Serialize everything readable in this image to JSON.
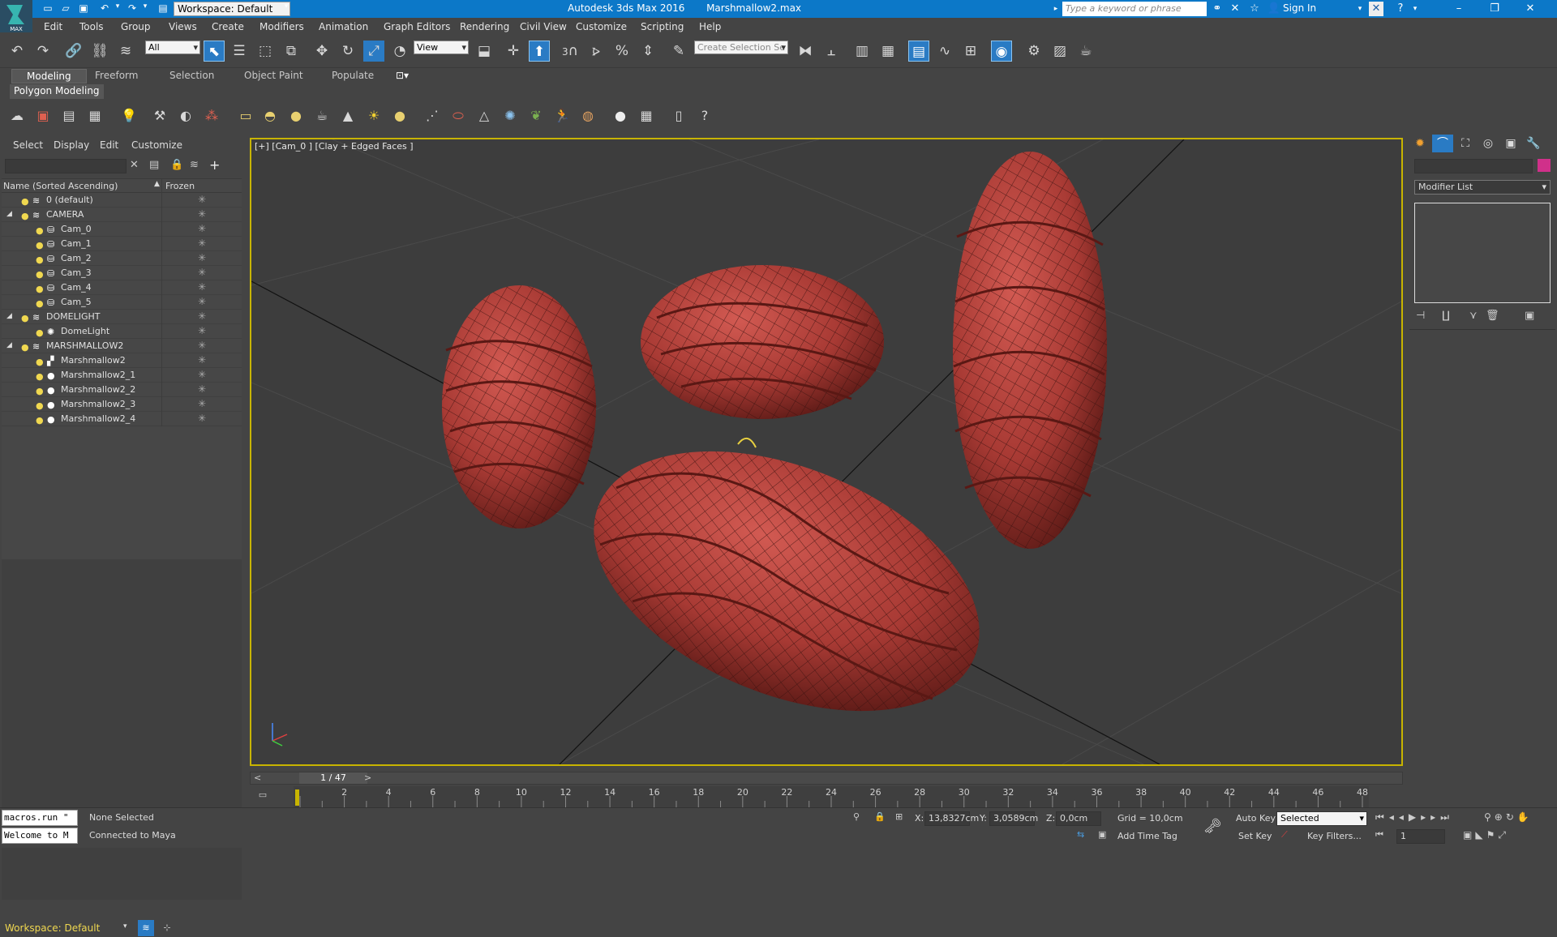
{
  "titlebar": {
    "workspace": "Workspace: Default",
    "app_title": "Autodesk 3ds Max 2016",
    "file_name": "Marshmallow2.max",
    "search_placeholder": "Type a keyword or phrase",
    "sign_in": "Sign In",
    "logo_text": "MAX"
  },
  "menu": [
    "Edit",
    "Tools",
    "Group",
    "Views",
    "Create",
    "Modifiers",
    "Animation",
    "Graph Editors",
    "Rendering",
    "Civil View",
    "Customize",
    "Scripting",
    "Help"
  ],
  "main_toolbar": {
    "selection_filter": "All",
    "ref_coord": "View",
    "selection_set_placeholder": "Create Selection Se",
    "snap_label": "3"
  },
  "ribbon": {
    "tabs": [
      "Modeling",
      "Freeform",
      "Selection",
      "Object Paint",
      "Populate"
    ],
    "active_tab": "Modeling",
    "sub_tab": "Polygon Modeling"
  },
  "explorer": {
    "menu": [
      "Select",
      "Display",
      "Edit",
      "Customize"
    ],
    "col_name": "Name (Sorted Ascending)",
    "col_frozen": "Frozen",
    "rows": [
      {
        "name": "0 (default)",
        "level": 0,
        "type": "layer",
        "expander": ""
      },
      {
        "name": "CAMERA",
        "level": 0,
        "type": "layer",
        "expander": "◢"
      },
      {
        "name": "Cam_0",
        "level": 1,
        "type": "camera",
        "expander": ""
      },
      {
        "name": "Cam_1",
        "level": 1,
        "type": "camera",
        "expander": ""
      },
      {
        "name": "Cam_2",
        "level": 1,
        "type": "camera",
        "expander": ""
      },
      {
        "name": "Cam_3",
        "level": 1,
        "type": "camera",
        "expander": ""
      },
      {
        "name": "Cam_4",
        "level": 1,
        "type": "camera",
        "expander": ""
      },
      {
        "name": "Cam_5",
        "level": 1,
        "type": "camera",
        "expander": ""
      },
      {
        "name": "DOMELIGHT",
        "level": 0,
        "type": "layer",
        "expander": "◢"
      },
      {
        "name": "DomeLight",
        "level": 1,
        "type": "light",
        "expander": ""
      },
      {
        "name": "MARSHMALLOW2",
        "level": 0,
        "type": "layer",
        "expander": "◢"
      },
      {
        "name": "Marshmallow2",
        "level": 1,
        "type": "mesh",
        "expander": ""
      },
      {
        "name": "Marshmallow2_1",
        "level": 1,
        "type": "sphere",
        "expander": ""
      },
      {
        "name": "Marshmallow2_2",
        "level": 1,
        "type": "sphere",
        "expander": ""
      },
      {
        "name": "Marshmallow2_3",
        "level": 1,
        "type": "sphere",
        "expander": ""
      },
      {
        "name": "Marshmallow2_4",
        "level": 1,
        "type": "sphere",
        "expander": ""
      }
    ],
    "workspace_bottom": "Workspace: Default"
  },
  "viewport": {
    "label": "[+] [Cam_0 ] [Clay + Edged Faces ]"
  },
  "command_panel": {
    "modifier_list": "Modifier List"
  },
  "timeline": {
    "frame_indicator": "1 / 47",
    "ticks": [
      "2",
      "4",
      "6",
      "8",
      "10",
      "12",
      "14",
      "16",
      "18",
      "20",
      "22",
      "24",
      "26",
      "28",
      "30",
      "32",
      "34",
      "36",
      "38",
      "40",
      "42",
      "44",
      "46",
      "48"
    ],
    "prev": "<",
    "next": ">"
  },
  "status": {
    "maxscript_line1": "macros.run \"",
    "maxscript_line2": "Welcome to M",
    "selection_status": "None Selected",
    "connection_status": "Connected to Maya",
    "x_label": "X:",
    "x_value": "13,8327cm",
    "y_label": "Y:",
    "y_value": "3,0589cm",
    "z_label": "Z:",
    "z_value": "0,0cm",
    "grid": "Grid = 10,0cm",
    "add_time_tag": "Add Time Tag",
    "auto_key": "Auto Key",
    "set_key": "Set Key",
    "key_mode": "Selected",
    "key_filters": "Key Filters...",
    "current_frame": "1"
  },
  "colors": {
    "titlebar": "#0c78c8",
    "ui_bg": "#444444",
    "viewport_bg": "#3d3d3d",
    "viewport_border": "#c8b400",
    "marshmallow": "#b8423c",
    "active_tool": "#2a7bc4"
  }
}
